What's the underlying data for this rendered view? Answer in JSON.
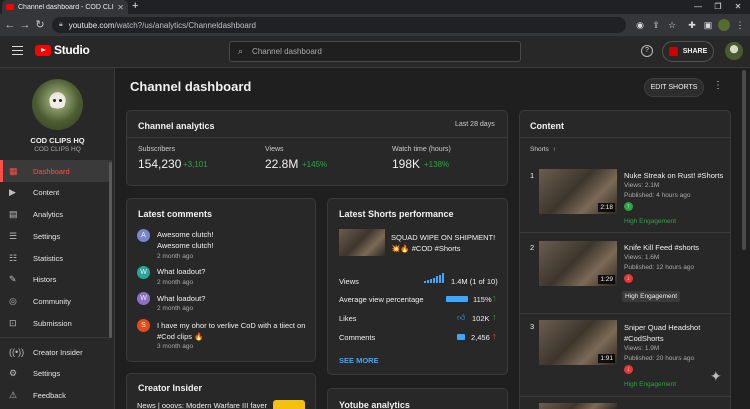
{
  "browser": {
    "tab_title": "Channel dashboard - COD CLIPS HQ",
    "tab_close": "✕",
    "new_tab": "+",
    "url_host": "youtube.com",
    "url_path": "/watch?/us/analytics/Channeldashboard",
    "nav_back": "←",
    "nav_forward": "→",
    "nav_reload": "↻"
  },
  "header": {
    "logo_text": "Studio",
    "search_placeholder": "Channel dashboard",
    "share_label": "SHARE",
    "help_glyph": "?"
  },
  "sidebar": {
    "channel_name": "COD CLIPS HQ",
    "channel_sub": "COD CLIPS HQ",
    "items": [
      {
        "label": "Dashboard",
        "icon": "dashboard-icon"
      },
      {
        "label": "Content",
        "icon": "content-icon"
      },
      {
        "label": "Analytics",
        "icon": "analytics-icon"
      },
      {
        "label": "Settings",
        "icon": "settings-icon"
      },
      {
        "label": "Statistics",
        "icon": "statistics-icon"
      },
      {
        "label": "Histors",
        "icon": "histors-icon"
      },
      {
        "label": "Community",
        "icon": "community-icon"
      },
      {
        "label": "Submission",
        "icon": "submission-icon"
      }
    ],
    "bottom_items": [
      {
        "label": "Creator Insider",
        "icon": "creator-insider-icon"
      },
      {
        "label": "Settings",
        "icon": "settings-icon"
      },
      {
        "label": "Feedback",
        "icon": "feedback-icon"
      }
    ]
  },
  "page": {
    "title": "Channel dashboard",
    "edit_shorts": "EDIT SHORTS",
    "more_glyph": "⋮"
  },
  "analytics": {
    "title": "Channel analytics",
    "period": "Last 28 days",
    "stats": [
      {
        "label": "Subscribers",
        "value": "154,230",
        "delta": "+3,101"
      },
      {
        "label": "Views",
        "value": "22.8M",
        "delta": "+145%"
      },
      {
        "label": "Watch time (hours)",
        "value": "198K",
        "delta": "+138%"
      }
    ]
  },
  "comments": {
    "title": "Latest comments",
    "items": [
      {
        "avatar": "A",
        "color": "#7986cb",
        "text": "Awesome clutch!\nAwesome clutch!",
        "time": "2 month ago"
      },
      {
        "avatar": "W",
        "color": "#26a69a",
        "text": "What loadout?",
        "time": "2 month ago"
      },
      {
        "avatar": "W",
        "color": "#8e6fc7",
        "text": "What loadout?",
        "time": "2 month ago"
      },
      {
        "avatar": "S",
        "color": "#e64a19",
        "text": "I have my ohor to verlive CoD with a tiiect on #Cod clips 🔥",
        "time": "3 month ago"
      }
    ]
  },
  "shorts_perf": {
    "title": "Latest Shorts performance",
    "video_title": "SQUAD WIPE ON SHIPMENT! 💥🔥 #COD #Shorts",
    "rows": [
      {
        "label": "Views",
        "value": "1.4M (1 of 10)"
      },
      {
        "label": "Average view percentage",
        "value": "115%"
      },
      {
        "label": "Likes",
        "value": "102K"
      },
      {
        "label": "Comments",
        "value": "2,456"
      }
    ],
    "see_more": "SEE MORE"
  },
  "creator_insider": {
    "title": "Creator Insider",
    "snippet": "News | ooovs: Modern Warfare III faver"
  },
  "youtube_analytics": {
    "title": "Yotube analytics"
  },
  "content": {
    "title": "Content",
    "sort_label": "Shorts",
    "items": [
      {
        "rank": "1",
        "title": "Nuke Streak on Rust! #Shorts",
        "views": "Views: 2.1M",
        "published": "Published: 4 hours ago",
        "badge": "High Engagement",
        "duration": "2:18"
      },
      {
        "rank": "2",
        "title": "Knife Kill Feed #shorts",
        "views": "Views: 1.6M",
        "published": "Published: 12 hours ago",
        "badge": "High Engagement",
        "duration": "1:29"
      },
      {
        "rank": "3",
        "title": "Sniper Quad Headshot #CodShorts",
        "views": "Views: 1.9M",
        "published": "Published: 20 hours ago",
        "badge": "High Engagement",
        "duration": "1:91"
      }
    ]
  }
}
